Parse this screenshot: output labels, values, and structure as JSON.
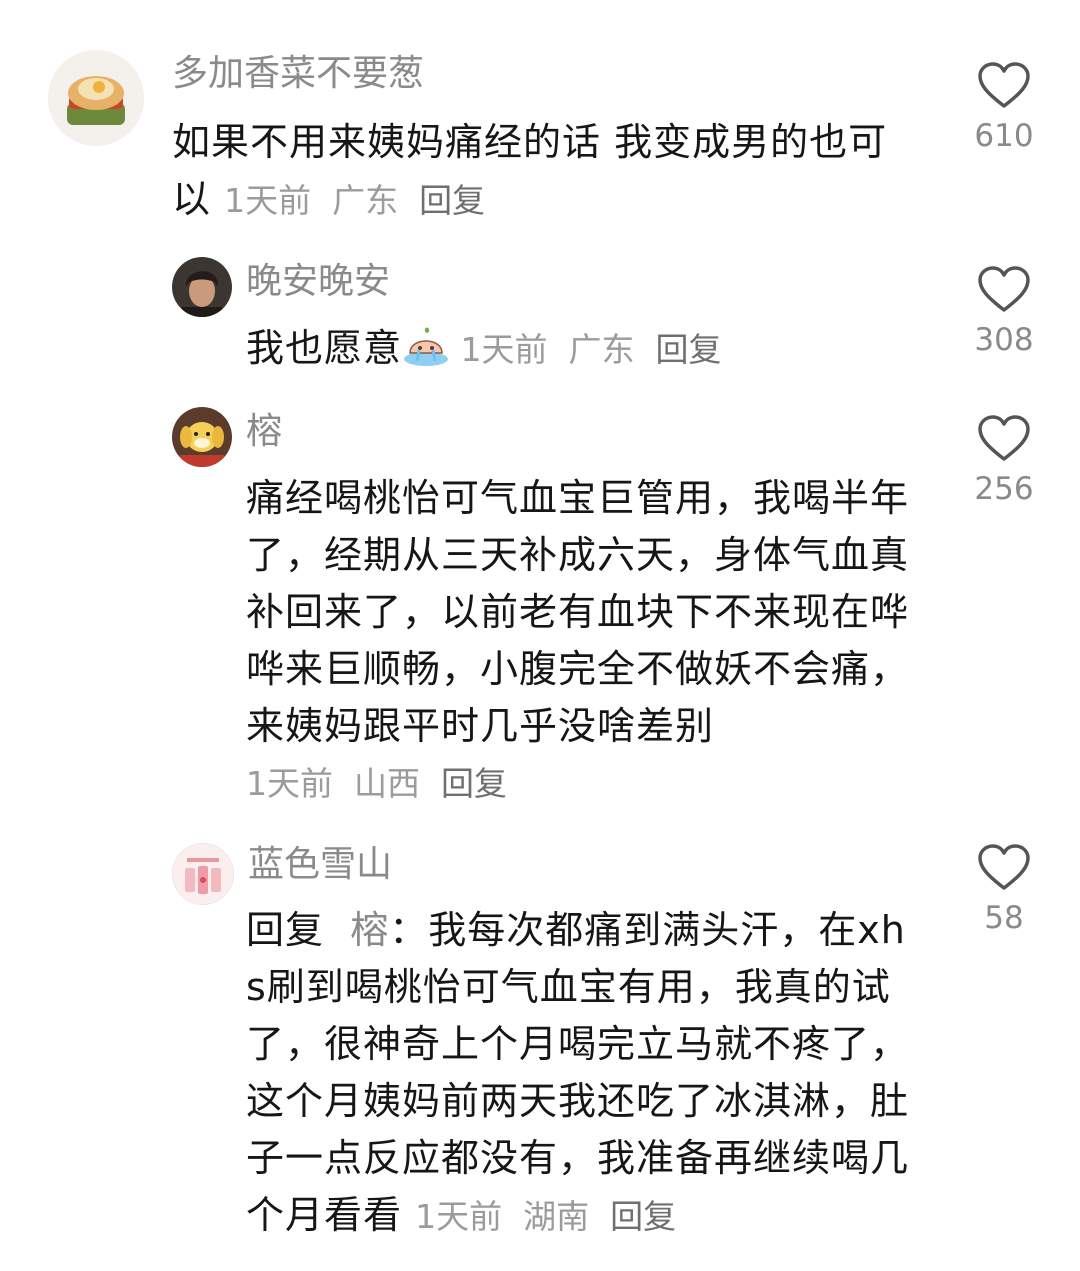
{
  "comments": [
    {
      "username": "多加香菜不要葱",
      "text": "如果不用来姨妈痛经的话 我变成男的也可以",
      "time": "1天前",
      "location": "广东",
      "reply_label": "回复",
      "likes": "610",
      "avatar_icon": "egg-toast-avatar"
    },
    {
      "username": "晚安晚安",
      "text": "我也愿意",
      "emoji_icon": "crying-peach-emoji",
      "time": "1天前",
      "location": "广东",
      "reply_label": "回复",
      "likes": "308",
      "avatar_icon": "man-portrait-avatar"
    },
    {
      "username": "榕",
      "text": "痛经喝桃怡可气血宝巨管用，我喝半年了，经期从三天补成六天，身体气血真补回来了，以前老有血块下不来现在哗哗来巨顺畅，小腹完全不做妖不会痛，来姨妈跟平时几乎没啥差别",
      "time": "1天前",
      "location": "山西",
      "reply_label": "回复",
      "likes": "256",
      "avatar_icon": "yellow-dog-avatar"
    },
    {
      "username": "蓝色雪山",
      "reply_prefix": "回复",
      "reply_target": "榕",
      "text": "：我每次都痛到满头汗，在xhs刷到喝桃怡可气血宝有用，我真的试了，很神奇上个月喝完立马就不疼了，这个月姨妈前两天我还吃了冰淇淋，肚子一点反应都没有，我准备再继续喝几个月看看",
      "time": "1天前",
      "location": "湖南",
      "reply_label": "回复",
      "likes": "58",
      "avatar_icon": "pink-card-avatar"
    }
  ],
  "colors": {
    "username": "#8a8a8a",
    "text": "#161616",
    "meta": "#9b9b9b",
    "heart_outline": "#555555"
  }
}
